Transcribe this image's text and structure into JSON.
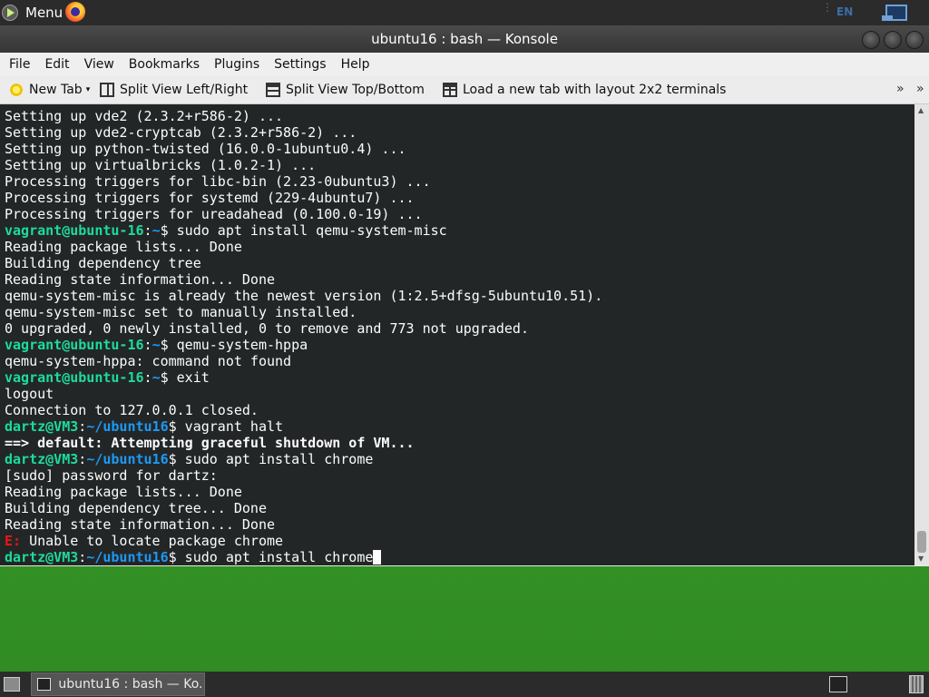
{
  "top_panel": {
    "menu_label": "Menu",
    "lang": "EN"
  },
  "window": {
    "title": "ubuntu16 : bash — Konsole"
  },
  "menubar": [
    "File",
    "Edit",
    "View",
    "Bookmarks",
    "Plugins",
    "Settings",
    "Help"
  ],
  "toolbar": {
    "new_tab": "New Tab",
    "split_lr": "Split View Left/Right",
    "split_tb": "Split View Top/Bottom",
    "layout_2x2": "Load a new tab with layout 2x2 terminals",
    "overflow": "»"
  },
  "terminal": {
    "lines": [
      "Setting up vde2 (2.3.2+r586-2) ...",
      "Setting up vde2-cryptcab (2.3.2+r586-2) ...",
      "Setting up python-twisted (16.0.0-1ubuntu0.4) ...",
      "Setting up virtualbricks (1.0.2-1) ...",
      "Processing triggers for libc-bin (2.23-0ubuntu3) ...",
      "Processing triggers for systemd (229-4ubuntu7) ...",
      "Processing triggers for ureadahead (0.100.0-19) ...",
      {
        "user": "vagrant@ubuntu-16",
        "path": "~",
        "sym": "$",
        "cmd": " sudo apt install qemu-system-misc"
      },
      "Reading package lists... Done",
      "Building dependency tree",
      "Reading state information... Done",
      "qemu-system-misc is already the newest version (1:2.5+dfsg-5ubuntu10.51).",
      "qemu-system-misc set to manually installed.",
      "0 upgraded, 0 newly installed, 0 to remove and 773 not upgraded.",
      {
        "user": "vagrant@ubuntu-16",
        "path": "~",
        "sym": "$",
        "cmd": " qemu-system-hppa"
      },
      "qemu-system-hppa: command not found",
      {
        "user": "vagrant@ubuntu-16",
        "path": "~",
        "sym": "$",
        "cmd": " exit"
      },
      "logout",
      "Connection to 127.0.0.1 closed.",
      {
        "user": "dartz@VM3",
        "path": "~/ubuntu16",
        "sym": "$",
        "cmd": " vagrant halt"
      },
      {
        "bold": "==> default: Attempting graceful shutdown of VM..."
      },
      {
        "user": "dartz@VM3",
        "path": "~/ubuntu16",
        "sym": "$",
        "cmd": " sudo apt install chrome"
      },
      "[sudo] password for dartz:",
      "Reading package lists... Done",
      "Building dependency tree... Done",
      "Reading state information... Done",
      {
        "error": "E:",
        "rest": " Unable to locate package chrome"
      },
      {
        "user": "dartz@VM3",
        "path": "~/ubuntu16",
        "sym": "$",
        "cmd": " sudo apt install chrome",
        "cursor": true
      }
    ]
  },
  "taskbar": {
    "task_label": "ubuntu16 : bash — Ko..."
  }
}
